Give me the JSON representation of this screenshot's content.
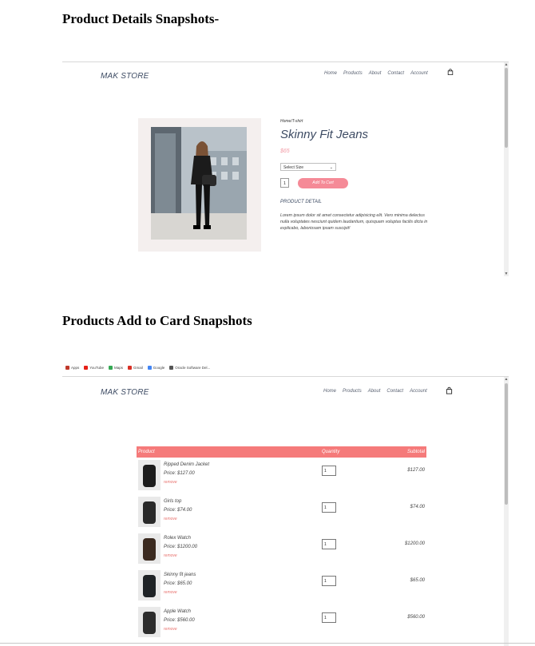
{
  "headings": {
    "product_details": "Product Details Snapshots-",
    "add_to_cart": "Products Add to Card Snapshots"
  },
  "store": {
    "logo": "MAK STORE",
    "nav": [
      "Home",
      "Products",
      "About",
      "Contact",
      "Account"
    ]
  },
  "product": {
    "breadcrumb": "Home/T-shirt",
    "title": "Skinny Fit Jeans",
    "price": "$65",
    "size_placeholder": "Select Size",
    "quantity": "1",
    "add_to_cart_label": "Add To Cart",
    "detail_heading": "PRODUCT DETAIL",
    "detail_text": "Lorem ipsum dolor sit amet consectetur adipisicing elit. Vero minima delectus nulla voluptates nesciunt quidem laudantium, quisquam voluptas facilis dicta in explicabo, laboriosam ipsam suscipit!"
  },
  "bookmarks": [
    {
      "label": "Apps",
      "icon": "apps-grid-icon",
      "color": "#c0392b"
    },
    {
      "label": "YouTube",
      "icon": "youtube-icon",
      "color": "#e62117"
    },
    {
      "label": "Maps",
      "icon": "maps-pin-icon",
      "color": "#34a853"
    },
    {
      "label": "Gmail",
      "icon": "gmail-icon",
      "color": "#d93025"
    },
    {
      "label": "Google",
      "icon": "google-icon",
      "color": "#4285f4"
    },
    {
      "label": "Oracle Software Del...",
      "icon": "globe-icon",
      "color": "#555555"
    }
  ],
  "cart": {
    "columns": {
      "product": "Product",
      "quantity": "Quantity",
      "subtotal": "Subtotal"
    },
    "remove_label": "remove",
    "items": [
      {
        "name": "Ripped Denim Jacket",
        "price": "Price: $127.00",
        "qty": "1",
        "subtotal": "$127.00"
      },
      {
        "name": "Girls top",
        "price": "Price: $74.00",
        "qty": "1",
        "subtotal": "$74.00"
      },
      {
        "name": "Rolex Watch",
        "price": "Price: $1200.00",
        "qty": "1",
        "subtotal": "$1200.00"
      },
      {
        "name": "Skinny fit jeans",
        "price": "Price: $65.00",
        "qty": "1",
        "subtotal": "$65.00"
      },
      {
        "name": "Apple Watch",
        "price": "Price: $560.00",
        "qty": "1",
        "subtotal": "$560.00"
      }
    ]
  },
  "colors": {
    "accent_pink": "#f58a97",
    "table_header": "#f57a7a",
    "remove_link": "#e8736f",
    "brand_text": "#3d4b63"
  }
}
